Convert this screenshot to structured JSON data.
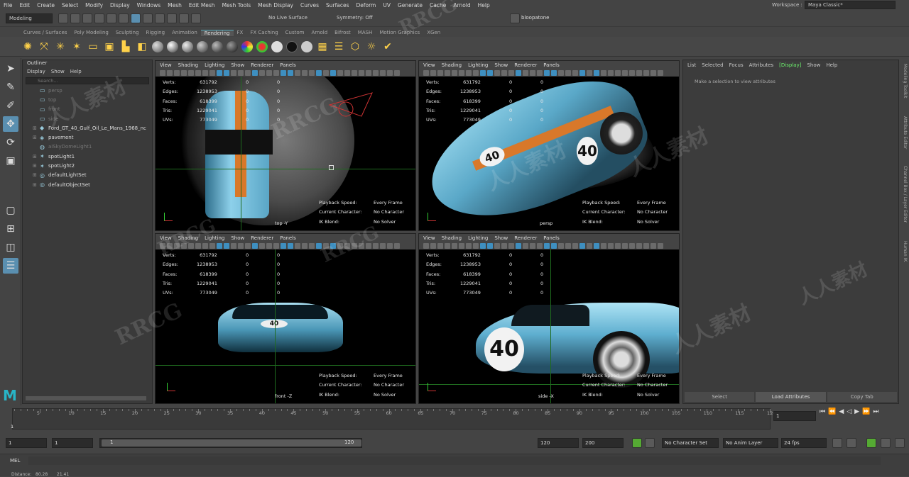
{
  "menubar": {
    "items": [
      "File",
      "Edit",
      "Create",
      "Select",
      "Modify",
      "Display",
      "Windows",
      "Mesh",
      "Edit Mesh",
      "Mesh Tools",
      "Mesh Display",
      "Curves",
      "Surfaces",
      "Deform",
      "UV",
      "Generate",
      "Cache",
      "Arnold",
      "Help"
    ],
    "workspace_label": "Workspace :",
    "workspace_value": "Maya Classic*"
  },
  "status": {
    "mode": "Modeling",
    "live_surface": "No Live Surface",
    "symmetry": "Symmetry: Off",
    "user": "bloopatone"
  },
  "shelf_tabs": [
    "Curves / Surfaces",
    "Poly Modeling",
    "Sculpting",
    "Rigging",
    "Animation",
    "Rendering",
    "FX",
    "FX Caching",
    "Custom",
    "Arnold",
    "Bifrost",
    "MASH",
    "Motion Graphics",
    "XGen"
  ],
  "shelf_active": "Rendering",
  "outliner": {
    "title": "Outliner",
    "menu": [
      "Display",
      "Show",
      "Help"
    ],
    "search_placeholder": "Search...",
    "items": [
      {
        "label": "persp",
        "dim": true
      },
      {
        "label": "top",
        "dim": true
      },
      {
        "label": "front",
        "dim": true
      },
      {
        "label": "side",
        "dim": true
      },
      {
        "label": "Ford_GT_40_Gulf_Oil_Le_Mans_1968_nc",
        "dim": false
      },
      {
        "label": "pavement",
        "dim": false
      },
      {
        "label": "aiSkyDomeLight1",
        "dim": true
      },
      {
        "label": "spotLight1",
        "dim": false
      },
      {
        "label": "spotLight2",
        "dim": false
      },
      {
        "label": "defaultLightSet",
        "dim": false
      },
      {
        "label": "defaultObjectSet",
        "dim": false
      }
    ]
  },
  "viewport_menu": [
    "View",
    "Shading",
    "Lighting",
    "Show",
    "Renderer",
    "Panels"
  ],
  "stats": {
    "labels": [
      "Verts:",
      "Edges:",
      "Faces:",
      "Tris:",
      "UVs:"
    ],
    "values": [
      "631792",
      "1238953",
      "618399",
      "1229041",
      "773049"
    ],
    "zero": "0"
  },
  "hud": {
    "labels": [
      "Playback Speed:",
      "Current Character:",
      "IK Blend:"
    ],
    "values": [
      "Every Frame",
      "No Character",
      "No Solver"
    ]
  },
  "viewports": {
    "top": "top -Y",
    "persp": "persp",
    "front": "front -Z",
    "side": "side -X"
  },
  "car_number": "40",
  "attribute_editor": {
    "menu": [
      "List",
      "Selected",
      "Focus",
      "Attributes",
      "[Display]",
      "Show",
      "Help"
    ],
    "message": "Make a selection to view attributes",
    "buttons": [
      "Select",
      "Load Attributes",
      "Copy Tab"
    ]
  },
  "side_tabs": [
    "Modeling Toolkit",
    "Attribute Editor",
    "Channel Box / Layer Editor",
    "Human IK"
  ],
  "timeline": {
    "ticks": [
      "5",
      "10",
      "15",
      "20",
      "25",
      "30",
      "35",
      "40",
      "45",
      "50",
      "55",
      "60",
      "65",
      "70",
      "75",
      "80",
      "85",
      "90",
      "95",
      "100",
      "105",
      "110",
      "115",
      "120"
    ],
    "current_frame": "1",
    "start_marker": "1"
  },
  "range": {
    "start": "1",
    "playback_start": "1",
    "slider_start": "1",
    "slider_end": "120",
    "playback_end": "120",
    "end": "200",
    "character_set": "No Character Set",
    "anim_layer": "No Anim Layer",
    "fps": "24 fps"
  },
  "cmdline": {
    "lang": "MEL",
    "distance_label": "Distance:",
    "distance_value": "80.28",
    "extra_value": "21.41"
  },
  "watermarks": [
    "RRCG",
    "人人素材",
    "RRCG",
    "人人素材",
    "RRCG",
    "人人素材",
    "RRCG",
    "人人素材",
    "RRCG",
    "人人素材"
  ]
}
